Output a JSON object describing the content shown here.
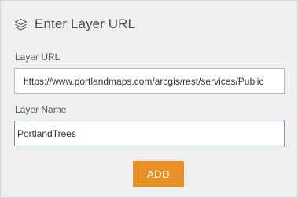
{
  "header": {
    "icon": "layers-icon",
    "title": "Enter Layer URL"
  },
  "form": {
    "url_label": "Layer URL",
    "url_value": "https://www.portlandmaps.com/arcgis/rest/services/Public",
    "name_label": "Layer Name",
    "name_value": "PortlandTrees"
  },
  "actions": {
    "add_label": "ADD"
  },
  "colors": {
    "panel_background": "#efefef",
    "add_button": "#e8912b",
    "focused_border": "#7d90a8"
  }
}
